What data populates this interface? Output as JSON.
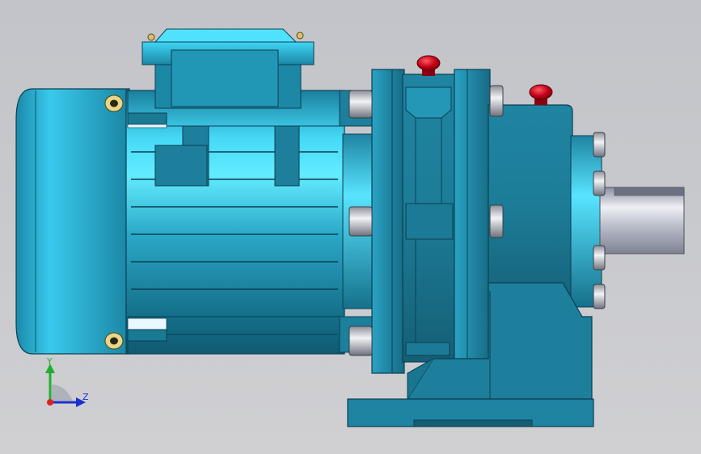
{
  "viewport": {
    "background_top": "#c2c4c9",
    "background_bottom": "#d0d0d3"
  },
  "model": {
    "body_color": "#1e7f99",
    "highlight_color": "#4fe6ff",
    "shaft_color": "#c8ccd6",
    "knob_color": "#c00018",
    "bolt_color": "#d9dde3"
  },
  "triad": {
    "y_label": "Y",
    "z_label": "Z",
    "y_color": "#20b030",
    "z_color": "#1a2fd0",
    "origin_color": "#e02020"
  }
}
